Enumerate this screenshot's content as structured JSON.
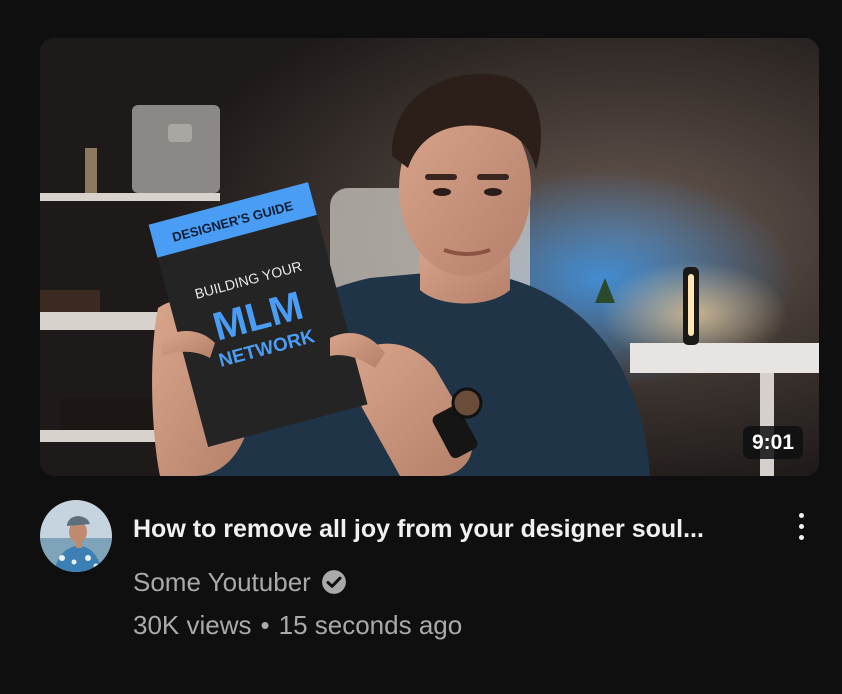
{
  "video": {
    "duration": "9:01",
    "title": "How to remove all joy from your designer soul...",
    "channel": "Some Youtuber",
    "views": "30K views",
    "separator": "•",
    "age": "15 seconds ago"
  },
  "book": {
    "band": "DESIGNER'S GUIDE",
    "line1": "BUILDING YOUR",
    "line2": "MLM",
    "line3": "NETWORK"
  },
  "icons": {
    "verified": "verified-check-icon",
    "more": "more-vert-icon"
  },
  "colors": {
    "background": "#0f0f0f",
    "title": "#f1f1f1",
    "meta": "#aaaaaa",
    "book_accent": "#4a9df5"
  }
}
